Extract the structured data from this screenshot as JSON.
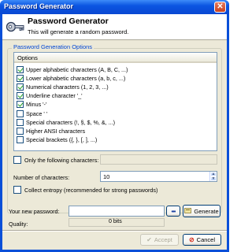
{
  "window": {
    "title": "Password Generator",
    "close_glyph": "✕"
  },
  "header": {
    "title": "Password Generator",
    "subtitle": "This will generate a random password.",
    "icon": "key-icon"
  },
  "options_group": {
    "legend": "Password Generation Options",
    "column_header": "Options",
    "items": [
      {
        "label": "Upper alphabetic characters (A, B, C, ...)",
        "checked": true
      },
      {
        "label": "Lower alphabetic characters (a, b, c, ...)",
        "checked": true
      },
      {
        "label": "Numerical characters (1, 2, 3, ...)",
        "checked": true
      },
      {
        "label": "Underline character '_'",
        "checked": true
      },
      {
        "label": "Minus '-'",
        "checked": true
      },
      {
        "label": "Space ' '",
        "checked": false
      },
      {
        "label": "Special characters (!, §, $, %, &, ...)",
        "checked": false
      },
      {
        "label": "Higher ANSI characters",
        "checked": false
      },
      {
        "label": "Special brackets ({, }, [, ], ...)",
        "checked": false
      }
    ],
    "only_following": {
      "label": "Only the following characters:",
      "checked": false,
      "value": ""
    },
    "num_chars": {
      "label": "Number of characters:",
      "value": "10"
    },
    "entropy": {
      "label": "Collect entropy (recommended for strong passwords)",
      "checked": false
    }
  },
  "result": {
    "label": "Your new password:",
    "value": "",
    "dots_button": "•••",
    "generate_button": "Generate",
    "quality_label": "Quality:",
    "quality_value": "0 bits"
  },
  "footer": {
    "accept_button": "Accept",
    "cancel_button": "Cancel"
  },
  "colors": {
    "accent": "#0046d5",
    "titlebar": "#0b55e2",
    "dialog_bg": "#ece9d8"
  }
}
